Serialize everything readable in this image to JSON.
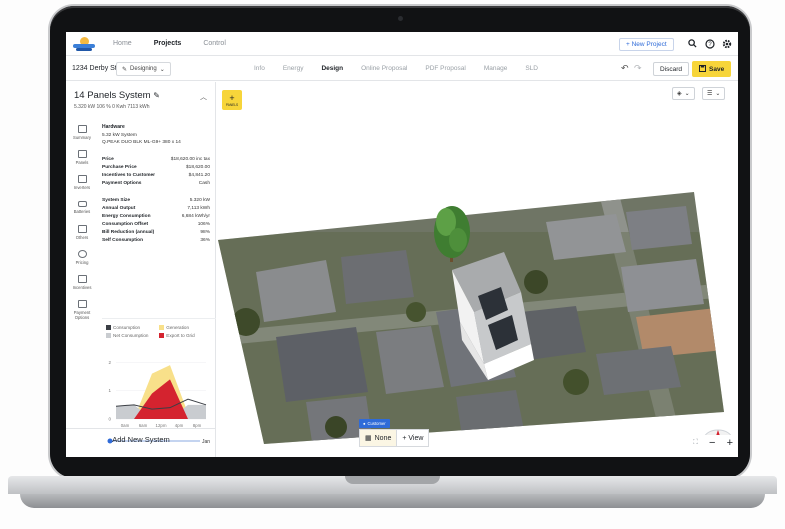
{
  "nav": {
    "items": [
      "Home",
      "Projects",
      "Control"
    ],
    "active": "Projects",
    "new_project": "+ New Project"
  },
  "project": {
    "address": "1234 Derby St",
    "status": "Designing",
    "tabs": [
      "Info",
      "Energy",
      "Design",
      "Online Proposal",
      "PDF Proposal",
      "Manage",
      "SLD"
    ],
    "active_tab": "Design",
    "discard": "Discard",
    "save": "Save"
  },
  "system": {
    "title": "14 Panels System",
    "subtitle": "5.320 kW  106 %  0 Kwh  7113 kWh"
  },
  "rail": [
    "Summary",
    "Panels",
    "Inverters",
    "Batteries",
    "Others",
    "Pricing",
    "Incentives",
    "Payment Options"
  ],
  "hardware": {
    "head": "Hardware",
    "lines": [
      "5.32 kW System",
      "Q.PEAK DUO BLK ML-G9+ 380 x 14"
    ]
  },
  "pricing": [
    {
      "k": "Price",
      "v": "$18,620.00 inc tax"
    },
    {
      "k": "Purchase Price",
      "v": "$18,620.00"
    },
    {
      "k": "Incentives to Customer",
      "v": "$4,841.20"
    },
    {
      "k": "Payment Options",
      "v": "Cash"
    }
  ],
  "stats": [
    {
      "k": "System Size",
      "v": "5.320 kW"
    },
    {
      "k": "Annual Output",
      "v": "7,113 kWh"
    },
    {
      "k": "Energy Consumption",
      "v": "6,684 kWh/yr"
    },
    {
      "k": "Consumption Offset",
      "v": "106%"
    },
    {
      "k": "Bill Reduction (annual)",
      "v": "98%"
    },
    {
      "k": "Self Consumption",
      "v": "36%"
    }
  ],
  "legend": [
    {
      "label": "Consumption",
      "color": "#3b3f45"
    },
    {
      "label": "Generation",
      "color": "#f8e08a"
    },
    {
      "label": "Net Consumption",
      "color": "#c9ccd0"
    },
    {
      "label": "Export to Grid",
      "color": "#d4232f"
    }
  ],
  "chart_data": {
    "type": "area",
    "x": [
      "0am",
      "6am",
      "12pm",
      "4pm",
      "8pm"
    ],
    "yticks": [
      0,
      1,
      2
    ],
    "ylim": [
      0,
      2.4
    ],
    "series": [
      {
        "name": "Consumption",
        "values": [
          0.45,
          0.5,
          0.35,
          0.4,
          0.7,
          0.5
        ]
      },
      {
        "name": "Generation",
        "values": [
          0,
          0,
          1.6,
          1.9,
          0.2,
          0
        ]
      },
      {
        "name": "Net Consumption",
        "values": [
          0.45,
          0.5,
          0.0,
          0.0,
          0.5,
          0.5
        ]
      },
      {
        "name": "Export to Grid",
        "values": [
          0,
          0,
          0.9,
          1.4,
          0,
          0
        ]
      }
    ],
    "month_label": "Jan"
  },
  "add_system": "Add New System",
  "map": {
    "panels_label": "PANELS",
    "customer_tag": "Customer",
    "none_label": "None",
    "view_label": "+ View"
  }
}
